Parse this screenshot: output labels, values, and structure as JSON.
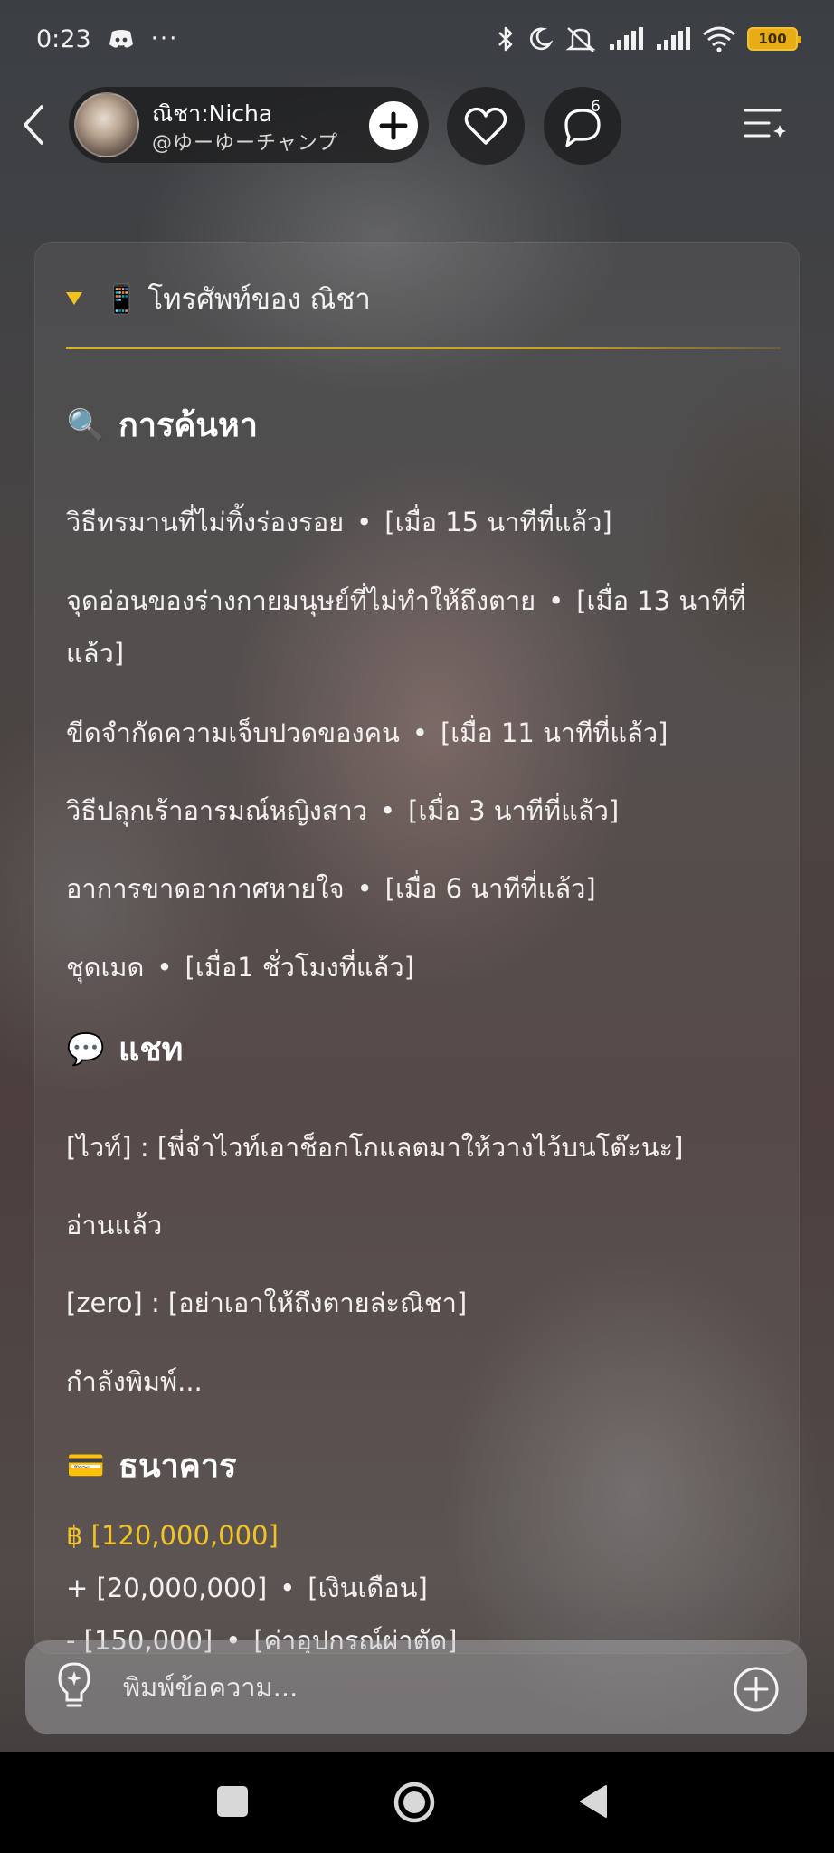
{
  "status_bar": {
    "time": "0:23",
    "battery": "100",
    "icons": [
      "discord-icon",
      "more-dots-icon",
      "bluetooth-icon",
      "moon-icon",
      "mute-icon",
      "signal-icon",
      "signal-icon",
      "wifi-icon",
      "battery-icon"
    ]
  },
  "header": {
    "profile_name": "ณิชา:Nicha",
    "profile_handle": "@ゆーゆーチャンプ",
    "comment_count": "6",
    "icons": [
      "back-icon",
      "plus-icon",
      "heart-icon",
      "comment-icon",
      "menu-icon"
    ]
  },
  "card": {
    "title": "📱 โทรศัพท์ของ ณิชา",
    "sections": {
      "search": {
        "icon": "🔍",
        "title": "การค้นหา",
        "items": [
          {
            "text": "วิธีทรมานที่ไม่ทิ้งร่องรอย",
            "sep": "•",
            "time": "[เมื่อ 15 นาทีที่แล้ว]"
          },
          {
            "text": "จุดอ่อนของร่างกายมนุษย์ที่ไม่ทำให้ถึงตาย",
            "sep": "•",
            "time": "[เมื่อ 13 นาทีที่แล้ว]"
          },
          {
            "text": "ขีดจำกัดความเจ็บปวดของคน",
            "sep": "•",
            "time": "[เมื่อ 11 นาทีที่แล้ว]"
          },
          {
            "text": "วิธีปลุกเร้าอารมณ์หญิงสาว",
            "sep": "•",
            "time": "[เมื่อ 3 นาทีที่แล้ว]"
          },
          {
            "text": "อาการขาดอากาศหายใจ",
            "sep": "•",
            "time": "[เมื่อ 6 นาทีที่แล้ว]"
          },
          {
            "text": "ชุดเมด",
            "sep": "•",
            "time": "[เมื่อ1 ชั่วโมงที่แล้ว]"
          }
        ]
      },
      "chat": {
        "icon": "💬",
        "title": "แชท",
        "messages": [
          "[ไวท์] : [พี่จำไวท์เอาช็อกโกแลตมาให้วางไว้บนโต๊ะนะ]",
          "อ่านแล้ว",
          "[zero] : [อย่าเอาให้ถึงตายล่ะณิชา]",
          "กำลังพิมพ์..."
        ]
      },
      "bank": {
        "icon": "💳",
        "title": "ธนาคาร",
        "balance": "฿ [120,000,000]",
        "transactions": [
          {
            "amount": "+ [20,000,000]",
            "sep": "•",
            "label": "[เงินเดือน]"
          },
          {
            "amount": "- [150,000]",
            "sep": "•",
            "label": "[ค่าอุปกรณ์ผ่าตัด]"
          }
        ]
      }
    }
  },
  "input": {
    "placeholder": "พิมพ์ข้อความ..."
  },
  "colors": {
    "accent": "#f4c21e",
    "card_bg": "rgba(255,255,255,0.06)",
    "input_bg": "rgba(185,185,190,0.42)"
  }
}
